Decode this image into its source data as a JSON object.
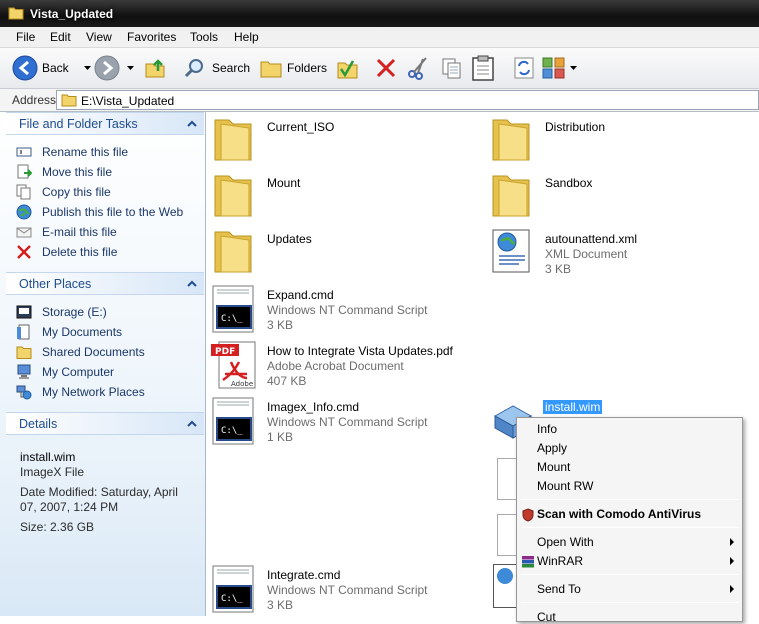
{
  "window": {
    "title": "Vista_Updated"
  },
  "menubar": {
    "items": [
      "File",
      "Edit",
      "View",
      "Favorites",
      "Tools",
      "Help"
    ]
  },
  "toolbar": {
    "back_label": "Back",
    "search_label": "Search",
    "folders_label": "Folders"
  },
  "address": {
    "label": "Address",
    "path": "E:\\Vista_Updated"
  },
  "left_pane": {
    "file_tasks": {
      "title": "File and Folder Tasks",
      "items": [
        "Rename this file",
        "Move this file",
        "Copy this file",
        "Publish this file to the Web",
        "E-mail this file",
        "Delete this file"
      ]
    },
    "other_places": {
      "title": "Other Places",
      "items": [
        "Storage (E:)",
        "My Documents",
        "Shared Documents",
        "My Computer",
        "My Network Places"
      ]
    },
    "details": {
      "title": "Details",
      "name": "install.wim",
      "type": "ImageX File",
      "modified_line1": "Date Modified: Saturday, April",
      "modified_line2": "07, 2007, 1:24 PM",
      "size": "Size: 2.36 GB"
    }
  },
  "files": {
    "current_iso": {
      "name": "Current_ISO"
    },
    "distribution": {
      "name": "Distribution"
    },
    "mount": {
      "name": "Mount"
    },
    "sandbox": {
      "name": "Sandbox"
    },
    "updates": {
      "name": "Updates"
    },
    "autounattend": {
      "name": "autounattend.xml",
      "type": "XML Document",
      "size": "3 KB"
    },
    "expand": {
      "name": "Expand.cmd",
      "type": "Windows NT Command Script",
      "size": "3 KB"
    },
    "pdf": {
      "name": "How to Integrate Vista Updates.pdf",
      "type": "Adobe Acrobat Document",
      "size": "407 KB"
    },
    "imagex_info": {
      "name": "Imagex_Info.cmd",
      "type": "Windows NT Command Script",
      "size": "1 KB"
    },
    "install_wim": {
      "name": "install.wim"
    },
    "integrate": {
      "name": "Integrate.cmd",
      "type": "Windows NT Command Script",
      "size": "3 KB"
    }
  },
  "context_menu": {
    "info": "Info",
    "apply": "Apply",
    "mount": "Mount",
    "mount_rw": "Mount RW",
    "scan": "Scan with Comodo AntiVirus",
    "open_with": "Open With",
    "winrar": "WinRAR",
    "send_to": "Send To",
    "cut": "Cut"
  },
  "icon_text": {
    "pdf_badge": "PDF",
    "adobe": "Adobe",
    "cmd_prompt": "C:\\_"
  }
}
